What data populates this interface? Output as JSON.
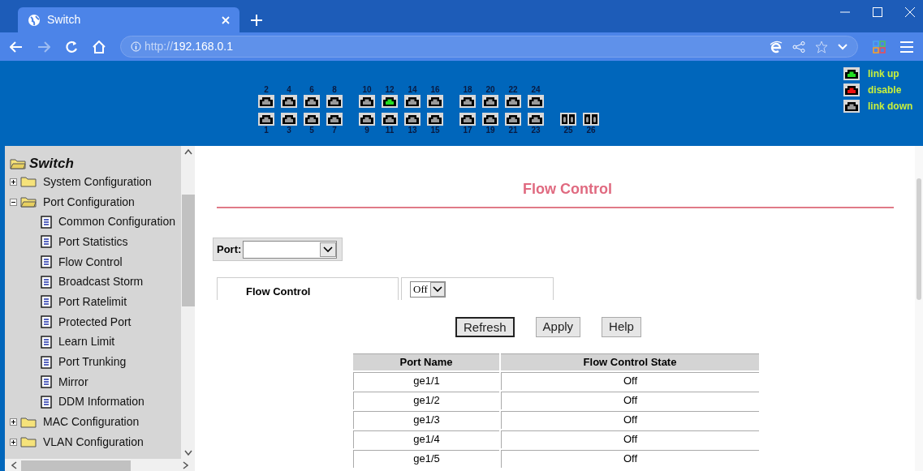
{
  "browser": {
    "tab": {
      "title": "Switch"
    },
    "url": {
      "scheme": "http://",
      "host": "192.168.0.1"
    }
  },
  "ports": {
    "groups": [
      {
        "columns": [
          {
            "top": {
              "label": "2",
              "color": "#9a9a9a"
            },
            "bottom": {
              "label": "1",
              "color": "#9a9a9a"
            }
          },
          {
            "top": {
              "label": "4",
              "color": "#9a9a9a"
            },
            "bottom": {
              "label": "3",
              "color": "#9a9a9a"
            }
          },
          {
            "top": {
              "label": "6",
              "color": "#9a9a9a"
            },
            "bottom": {
              "label": "5",
              "color": "#9a9a9a"
            }
          },
          {
            "top": {
              "label": "8",
              "color": "#9a9a9a"
            },
            "bottom": {
              "label": "7",
              "color": "#9a9a9a"
            }
          }
        ]
      },
      {
        "columns": [
          {
            "top": {
              "label": "10",
              "color": "#9a9a9a"
            },
            "bottom": {
              "label": "9",
              "color": "#9a9a9a"
            }
          },
          {
            "top": {
              "label": "12",
              "color": "#22dd22"
            },
            "bottom": {
              "label": "11",
              "color": "#9a9a9a"
            }
          },
          {
            "top": {
              "label": "14",
              "color": "#9a9a9a"
            },
            "bottom": {
              "label": "13",
              "color": "#9a9a9a"
            }
          },
          {
            "top": {
              "label": "16",
              "color": "#9a9a9a"
            },
            "bottom": {
              "label": "15",
              "color": "#9a9a9a"
            }
          }
        ]
      },
      {
        "columns": [
          {
            "top": {
              "label": "18",
              "color": "#9a9a9a"
            },
            "bottom": {
              "label": "17",
              "color": "#9a9a9a"
            }
          },
          {
            "top": {
              "label": "20",
              "color": "#9a9a9a"
            },
            "bottom": {
              "label": "19",
              "color": "#9a9a9a"
            }
          },
          {
            "top": {
              "label": "22",
              "color": "#9a9a9a"
            },
            "bottom": {
              "label": "21",
              "color": "#9a9a9a"
            }
          },
          {
            "top": {
              "label": "24",
              "color": "#9a9a9a"
            },
            "bottom": {
              "label": "23",
              "color": "#9a9a9a"
            }
          }
        ]
      },
      {
        "columns": [
          {
            "bottom": {
              "label": "25",
              "kind": "fiber"
            }
          },
          {
            "bottom": {
              "label": "26",
              "kind": "fiber"
            }
          }
        ]
      }
    ],
    "legend": [
      {
        "label": "link up",
        "color": "#22dd22"
      },
      {
        "label": "disable",
        "color": "#ee1111"
      },
      {
        "label": "link down",
        "color": "#9a9a9a"
      }
    ]
  },
  "sidebar": {
    "tree": {
      "label": "Switch",
      "expanded": true,
      "children": [
        {
          "label": "System Configuration",
          "expanded": false
        },
        {
          "label": "Port Configuration",
          "expanded": true,
          "children": [
            {
              "label": "Common Configuration"
            },
            {
              "label": "Port Statistics"
            },
            {
              "label": "Flow Control"
            },
            {
              "label": "Broadcast Storm"
            },
            {
              "label": "Port Ratelimit"
            },
            {
              "label": "Protected Port"
            },
            {
              "label": "Learn Limit"
            },
            {
              "label": "Port Trunking"
            },
            {
              "label": "Mirror"
            },
            {
              "label": "DDM Information"
            }
          ]
        },
        {
          "label": "MAC Configuration",
          "expanded": false
        },
        {
          "label": "VLAN Configuration",
          "expanded": false
        }
      ]
    }
  },
  "content": {
    "title": "Flow Control",
    "port_label": "Port:",
    "setting": {
      "label": "Flow Control",
      "value": "Off"
    },
    "buttons": [
      {
        "label": "Refresh",
        "focused": true
      },
      {
        "label": "Apply",
        "focused": false
      },
      {
        "label": "Help",
        "focused": false
      }
    ],
    "table": {
      "columns": [
        "Port Name",
        "Flow Control State"
      ],
      "rows": [
        [
          "ge1/1",
          "Off"
        ],
        [
          "ge1/2",
          "Off"
        ],
        [
          "ge1/3",
          "Off"
        ],
        [
          "ge1/4",
          "Off"
        ],
        [
          "ge1/5",
          "Off"
        ]
      ]
    }
  }
}
